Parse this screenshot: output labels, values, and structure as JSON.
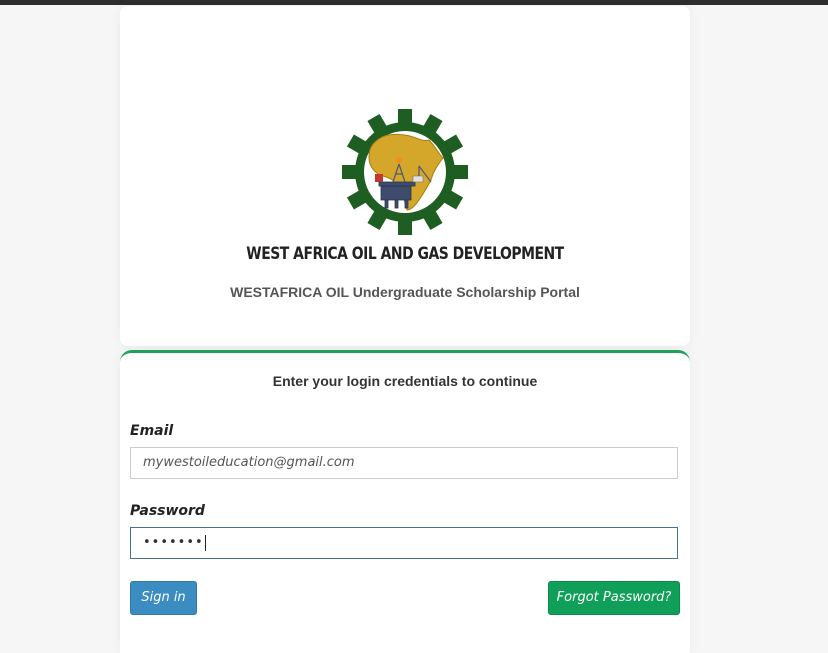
{
  "header": {
    "org_name": "WEST AFRICA OIL AND GAS DEVELOPMENT",
    "portal_name": "WESTAFRICA OIL Undergraduate Scholarship Portal"
  },
  "login": {
    "title": "Enter your login credentials to continue",
    "email_label": "Email",
    "email_value": "mywestoileducation@gmail.com",
    "password_label": "Password",
    "password_value": "•••••••",
    "signin_label": "Sign in",
    "forgot_label": "Forgot Password?"
  },
  "colors": {
    "accent_green": "#1fa15a",
    "signin_blue": "#3b8cc1",
    "forgot_green": "#0f9f58",
    "logo_gear": "#1f5e22",
    "logo_gold": "#d4a62a"
  }
}
